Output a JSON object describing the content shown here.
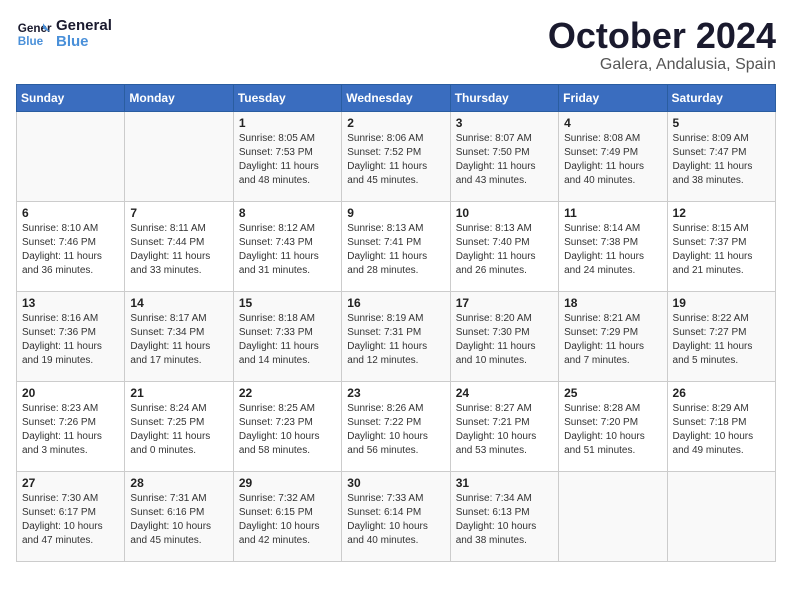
{
  "header": {
    "logo_line1": "General",
    "logo_line2": "Blue",
    "month": "October 2024",
    "location": "Galera, Andalusia, Spain"
  },
  "days_of_week": [
    "Sunday",
    "Monday",
    "Tuesday",
    "Wednesday",
    "Thursday",
    "Friday",
    "Saturday"
  ],
  "weeks": [
    [
      {
        "day": "",
        "info": ""
      },
      {
        "day": "",
        "info": ""
      },
      {
        "day": "1",
        "info": "Sunrise: 8:05 AM\nSunset: 7:53 PM\nDaylight: 11 hours and 48 minutes."
      },
      {
        "day": "2",
        "info": "Sunrise: 8:06 AM\nSunset: 7:52 PM\nDaylight: 11 hours and 45 minutes."
      },
      {
        "day": "3",
        "info": "Sunrise: 8:07 AM\nSunset: 7:50 PM\nDaylight: 11 hours and 43 minutes."
      },
      {
        "day": "4",
        "info": "Sunrise: 8:08 AM\nSunset: 7:49 PM\nDaylight: 11 hours and 40 minutes."
      },
      {
        "day": "5",
        "info": "Sunrise: 8:09 AM\nSunset: 7:47 PM\nDaylight: 11 hours and 38 minutes."
      }
    ],
    [
      {
        "day": "6",
        "info": "Sunrise: 8:10 AM\nSunset: 7:46 PM\nDaylight: 11 hours and 36 minutes."
      },
      {
        "day": "7",
        "info": "Sunrise: 8:11 AM\nSunset: 7:44 PM\nDaylight: 11 hours and 33 minutes."
      },
      {
        "day": "8",
        "info": "Sunrise: 8:12 AM\nSunset: 7:43 PM\nDaylight: 11 hours and 31 minutes."
      },
      {
        "day": "9",
        "info": "Sunrise: 8:13 AM\nSunset: 7:41 PM\nDaylight: 11 hours and 28 minutes."
      },
      {
        "day": "10",
        "info": "Sunrise: 8:13 AM\nSunset: 7:40 PM\nDaylight: 11 hours and 26 minutes."
      },
      {
        "day": "11",
        "info": "Sunrise: 8:14 AM\nSunset: 7:38 PM\nDaylight: 11 hours and 24 minutes."
      },
      {
        "day": "12",
        "info": "Sunrise: 8:15 AM\nSunset: 7:37 PM\nDaylight: 11 hours and 21 minutes."
      }
    ],
    [
      {
        "day": "13",
        "info": "Sunrise: 8:16 AM\nSunset: 7:36 PM\nDaylight: 11 hours and 19 minutes."
      },
      {
        "day": "14",
        "info": "Sunrise: 8:17 AM\nSunset: 7:34 PM\nDaylight: 11 hours and 17 minutes."
      },
      {
        "day": "15",
        "info": "Sunrise: 8:18 AM\nSunset: 7:33 PM\nDaylight: 11 hours and 14 minutes."
      },
      {
        "day": "16",
        "info": "Sunrise: 8:19 AM\nSunset: 7:31 PM\nDaylight: 11 hours and 12 minutes."
      },
      {
        "day": "17",
        "info": "Sunrise: 8:20 AM\nSunset: 7:30 PM\nDaylight: 11 hours and 10 minutes."
      },
      {
        "day": "18",
        "info": "Sunrise: 8:21 AM\nSunset: 7:29 PM\nDaylight: 11 hours and 7 minutes."
      },
      {
        "day": "19",
        "info": "Sunrise: 8:22 AM\nSunset: 7:27 PM\nDaylight: 11 hours and 5 minutes."
      }
    ],
    [
      {
        "day": "20",
        "info": "Sunrise: 8:23 AM\nSunset: 7:26 PM\nDaylight: 11 hours and 3 minutes."
      },
      {
        "day": "21",
        "info": "Sunrise: 8:24 AM\nSunset: 7:25 PM\nDaylight: 11 hours and 0 minutes."
      },
      {
        "day": "22",
        "info": "Sunrise: 8:25 AM\nSunset: 7:23 PM\nDaylight: 10 hours and 58 minutes."
      },
      {
        "day": "23",
        "info": "Sunrise: 8:26 AM\nSunset: 7:22 PM\nDaylight: 10 hours and 56 minutes."
      },
      {
        "day": "24",
        "info": "Sunrise: 8:27 AM\nSunset: 7:21 PM\nDaylight: 10 hours and 53 minutes."
      },
      {
        "day": "25",
        "info": "Sunrise: 8:28 AM\nSunset: 7:20 PM\nDaylight: 10 hours and 51 minutes."
      },
      {
        "day": "26",
        "info": "Sunrise: 8:29 AM\nSunset: 7:18 PM\nDaylight: 10 hours and 49 minutes."
      }
    ],
    [
      {
        "day": "27",
        "info": "Sunrise: 7:30 AM\nSunset: 6:17 PM\nDaylight: 10 hours and 47 minutes."
      },
      {
        "day": "28",
        "info": "Sunrise: 7:31 AM\nSunset: 6:16 PM\nDaylight: 10 hours and 45 minutes."
      },
      {
        "day": "29",
        "info": "Sunrise: 7:32 AM\nSunset: 6:15 PM\nDaylight: 10 hours and 42 minutes."
      },
      {
        "day": "30",
        "info": "Sunrise: 7:33 AM\nSunset: 6:14 PM\nDaylight: 10 hours and 40 minutes."
      },
      {
        "day": "31",
        "info": "Sunrise: 7:34 AM\nSunset: 6:13 PM\nDaylight: 10 hours and 38 minutes."
      },
      {
        "day": "",
        "info": ""
      },
      {
        "day": "",
        "info": ""
      }
    ]
  ]
}
